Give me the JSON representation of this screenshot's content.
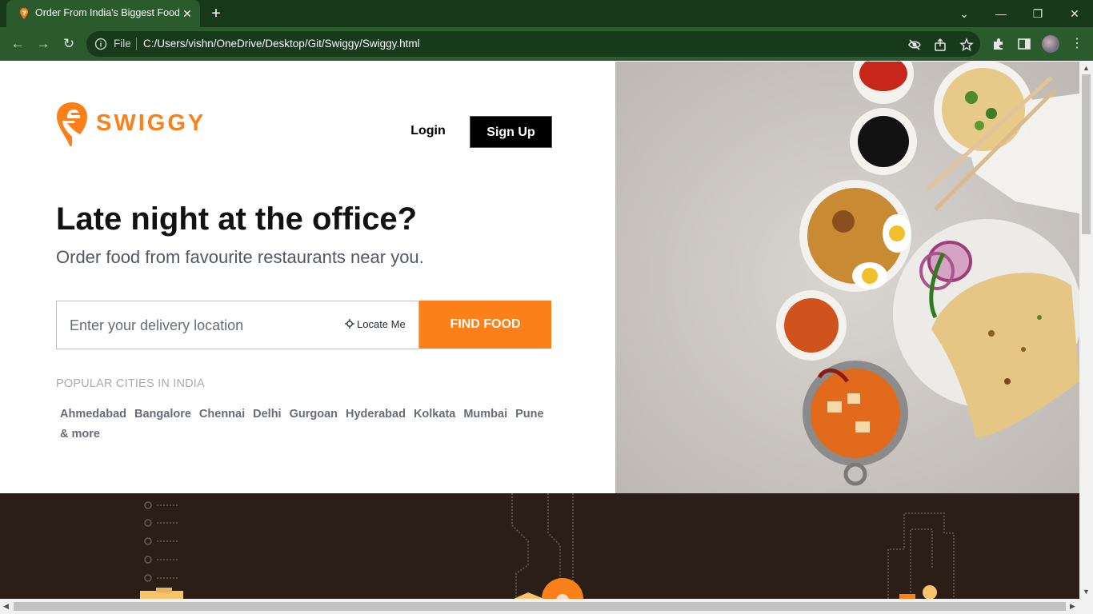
{
  "browser": {
    "tab_title": "Order From India's Biggest Food",
    "file_label": "File",
    "url": "C:/Users/vishn/OneDrive/Desktop/Git/Swiggy/Swiggy.html"
  },
  "header": {
    "brand": "SWIGGY",
    "login_label": "Login",
    "signup_label": "Sign Up"
  },
  "hero": {
    "headline": "Late night at the office?",
    "subline": "Order food from favourite restaurants near you."
  },
  "search": {
    "placeholder": "Enter your delivery location",
    "locate_label": "Locate Me",
    "button_label": "FIND FOOD"
  },
  "popular": {
    "title": "POPULAR CITIES IN INDIA",
    "cities": [
      "Ahmedabad",
      "Bangalore",
      "Chennai",
      "Delhi",
      "Gurgoan",
      "Hyderabad",
      "Kolkata",
      "Mumbai",
      "Pune",
      "& more"
    ]
  },
  "colors": {
    "brand": "#fc8019",
    "browser_frame": "#2b5a2c",
    "band": "#2b1e16"
  }
}
